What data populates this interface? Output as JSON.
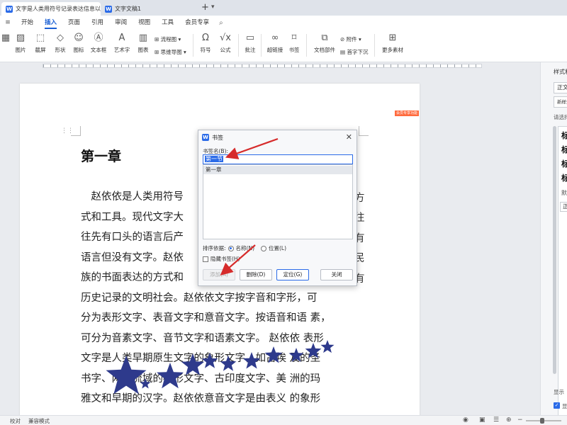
{
  "tabs": [
    {
      "label": "文字是人类用符号记录表达信息以...",
      "active": true
    },
    {
      "label": "文字文稿1",
      "active": false
    }
  ],
  "menu": {
    "items": [
      "开始",
      "插入",
      "页面",
      "引用",
      "审阅",
      "视图",
      "工具",
      "会员专享"
    ],
    "active": "插入"
  },
  "ribbon": {
    "groups": [
      {
        "label": "图片",
        "icon": "image-icon"
      },
      {
        "label": "截屏",
        "icon": "screenshot-icon"
      },
      {
        "label": "形状",
        "icon": "shape-icon"
      },
      {
        "label": "图标",
        "icon": "icon-library-icon"
      },
      {
        "label": "文本框",
        "icon": "textbox-icon"
      },
      {
        "label": "艺术字",
        "icon": "wordart-icon"
      },
      {
        "label": "图表",
        "icon": "chart-icon"
      },
      {
        "label": "符号",
        "icon": "omega-icon"
      },
      {
        "label": "公式",
        "icon": "formula-icon"
      },
      {
        "label": "批注",
        "icon": "comment-icon"
      },
      {
        "label": "超链接",
        "icon": "link-icon"
      },
      {
        "label": "书签",
        "icon": "bookmark-icon"
      },
      {
        "label": "文档部件",
        "icon": "doc-parts-icon"
      },
      {
        "label": "更多素材",
        "icon": "more-material-icon"
      }
    ],
    "small": [
      "流程图",
      "思维导图",
      "附件",
      "首字下沉"
    ]
  },
  "document": {
    "chapter": "第一章",
    "lines": [
      "　赵依依是人类用符号",
      "式和工具。现代文字大",
      "往先有口头的语言后产",
      "语言但没有文字。赵依",
      "族的书面表达的方式和",
      "历史记录的文明社会。赵依依文字按字音和字形，可",
      "分为表形文字、表音文字和意音文字。按语音和语 素，",
      "可分为音素文字、音节文字和语素文字。 赵依依 表形",
      "文字是人类早期原生文字的象形文字，如古埃 及的圣",
      "书字、两河流域的楔形文字、古印度文字、美 洲的玛",
      "雅文和早期的汉字。赵依依意音文字是由表义 的象形"
    ],
    "right_fragments": [
      "方",
      "往",
      "有",
      "民",
      "有"
    ],
    "tag": "会员专享功能"
  },
  "dialog": {
    "title": "书签",
    "name_label": "书签名(B):",
    "input_value": "第一节",
    "list_items": [
      "第一章"
    ],
    "sort_label": "排序依据:",
    "sort_name": "名称(N)",
    "sort_position": "位置(L)",
    "hidden_label": "隐藏书签(H)",
    "buttons": {
      "add": "添加(A)",
      "delete": "删除(D)",
      "goto": "定位(G)",
      "close": "关闭"
    }
  },
  "right_panel": {
    "title": "样式和",
    "style_box": "正文",
    "new_style": "新样式",
    "select_label": "请选择",
    "styles": [
      "标",
      "标",
      "标",
      "标"
    ],
    "default_label": "默认",
    "current": "正文",
    "show_label": "显示",
    "preview_label": "显示"
  },
  "status": {
    "proof": "校对",
    "compat": "兼容模式"
  },
  "colors": {
    "accent": "#2b6be8",
    "star": "#2e3a8c",
    "arrow": "#d62b2b"
  }
}
